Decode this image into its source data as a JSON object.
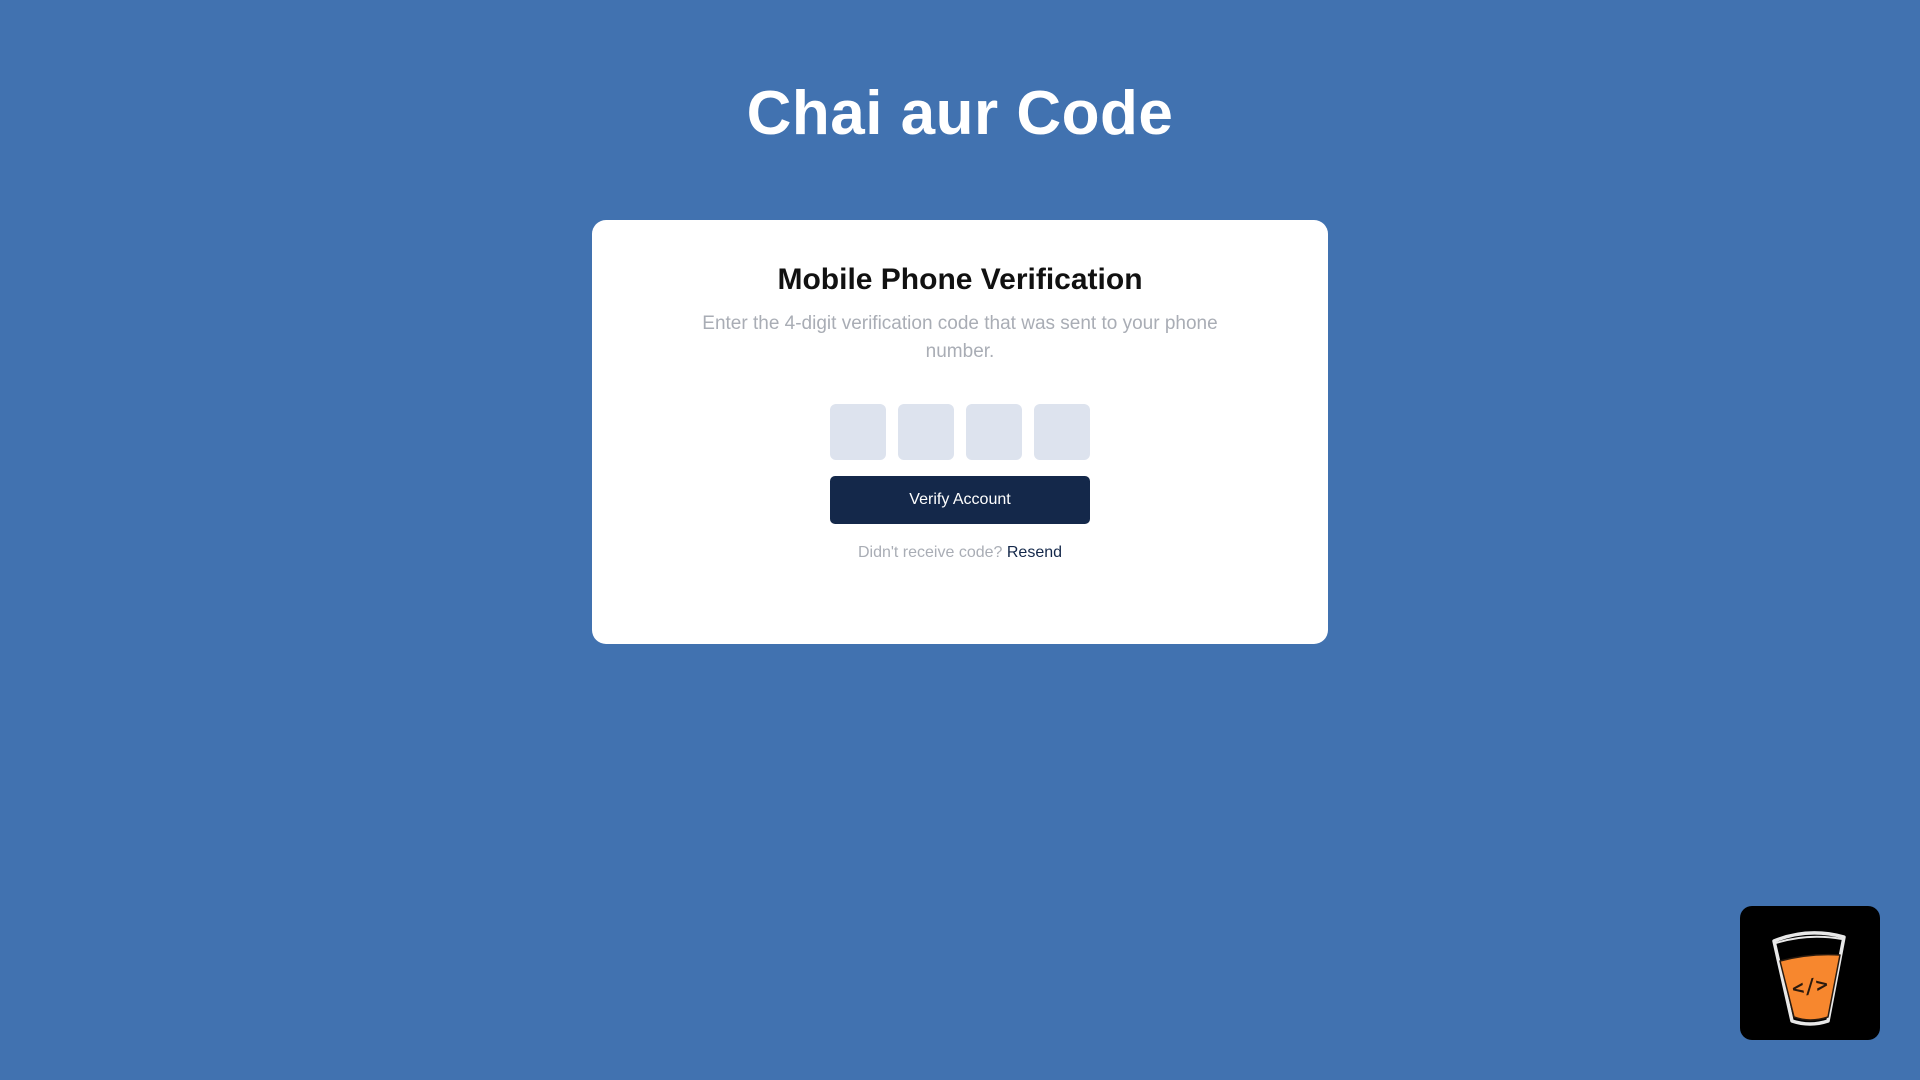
{
  "site": {
    "title": "Chai aur Code"
  },
  "verification": {
    "title": "Mobile Phone Verification",
    "description": "Enter the 4-digit verification code that was sent to your phone number.",
    "code_digits": [
      "",
      "",
      "",
      ""
    ],
    "verify_label": "Verify Account",
    "resend_prompt": "Didn't receive code?",
    "resend_label": "Resend"
  },
  "logo": {
    "icon": "chai-code-cup-icon",
    "text": "</>"
  },
  "colors": {
    "background": "#4172b0",
    "card": "#ffffff",
    "input_fill": "#dde3ee",
    "button": "#14284a",
    "muted_text": "#a9adb5",
    "logo_bg": "#000000",
    "logo_accent": "#f7872e"
  }
}
